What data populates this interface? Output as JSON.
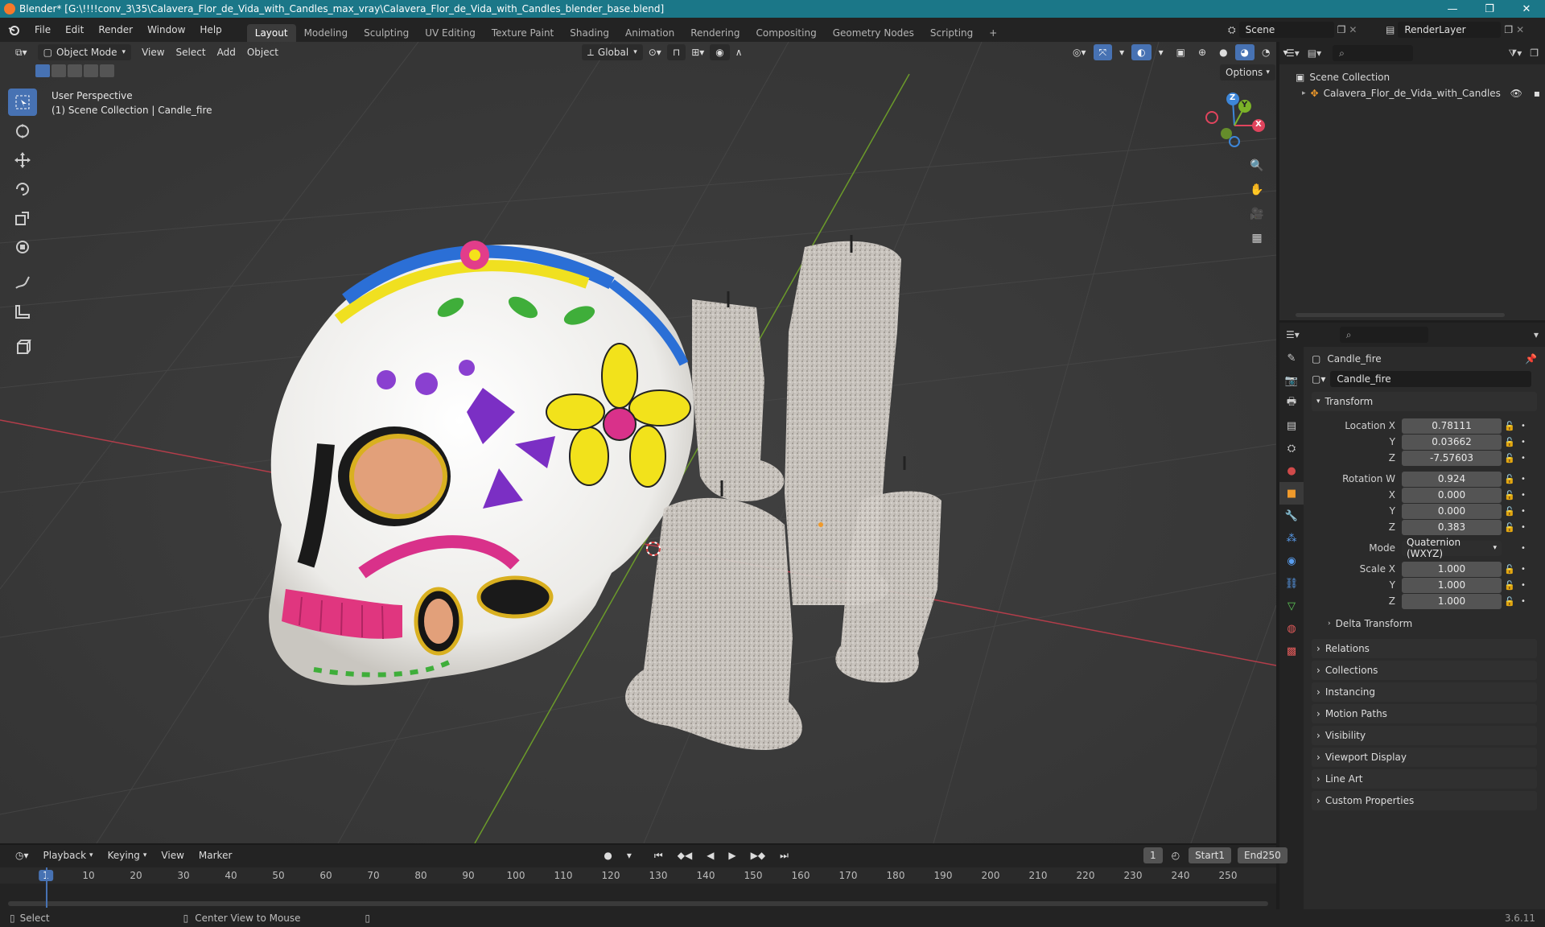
{
  "title_bar": {
    "title": "Blender* [G:\\!!!!conv_3\\35\\Calavera_Flor_de_Vida_with_Candles_max_vray\\Calavera_Flor_de_Vida_with_Candles_blender_base.blend]",
    "minimize": "—",
    "maximize": "❐",
    "close": "✕"
  },
  "menu": [
    "File",
    "Edit",
    "Render",
    "Window",
    "Help"
  ],
  "workspaces": [
    "Layout",
    "Modeling",
    "Sculpting",
    "UV Editing",
    "Texture Paint",
    "Shading",
    "Animation",
    "Rendering",
    "Compositing",
    "Geometry Nodes",
    "Scripting"
  ],
  "workspace_add": "+",
  "scene": {
    "name": "Scene",
    "view_layer": "RenderLayer"
  },
  "viewport": {
    "mode": "Object Mode",
    "menus": [
      "View",
      "Select",
      "Add",
      "Object"
    ],
    "orientation": "Global",
    "options_label": "Options",
    "info_line1": "User Perspective",
    "info_line2": "(1) Scene Collection | Candle_fire"
  },
  "gizmo": {
    "x": "X",
    "y": "Y",
    "z": "Z"
  },
  "colors": {
    "accent": "#4772b3",
    "titlebar": "#1b7788",
    "axis_x": "#e0445d",
    "axis_y": "#7bb228",
    "axis_z": "#3d86d8",
    "origin": "#f09a2b"
  },
  "outliner": {
    "root": "Scene Collection",
    "items": [
      {
        "name": "Calavera_Flor_de_Vida_with_Candles"
      }
    ]
  },
  "properties": {
    "object_name": "Candle_fire",
    "data_name": "Candle_fire",
    "transform_label": "Transform",
    "location_label": "Location X",
    "location": {
      "x": "0.78111",
      "y": "0.03662",
      "z": "-7.57603"
    },
    "rotation_label": "Rotation W",
    "rotation": {
      "w": "0.924",
      "x": "0.000",
      "y": "0.000",
      "z": "0.383"
    },
    "mode_label": "Mode",
    "mode_value": "Quaternion (WXYZ)",
    "scale_label": "Scale X",
    "scale": {
      "x": "1.000",
      "y": "1.000",
      "z": "1.000"
    },
    "axis_y": "Y",
    "axis_x": "X",
    "axis_z": "Z",
    "delta_transform": "Delta Transform",
    "panels": [
      "Relations",
      "Collections",
      "Instancing",
      "Motion Paths",
      "Visibility",
      "Viewport Display",
      "Line Art",
      "Custom Properties"
    ]
  },
  "timeline": {
    "menus": [
      "Playback",
      "Keying",
      "View",
      "Marker"
    ],
    "current_frame": "1",
    "start_label": "Start",
    "start": "1",
    "end_label": "End",
    "end": "250",
    "ruler": [
      "1",
      "10",
      "20",
      "30",
      "40",
      "50",
      "60",
      "70",
      "80",
      "90",
      "100",
      "110",
      "120",
      "130",
      "140",
      "150",
      "160",
      "170",
      "180",
      "190",
      "200",
      "210",
      "220",
      "230",
      "240",
      "250"
    ]
  },
  "status": {
    "select": "Select",
    "center_view": "Center View to Mouse",
    "version": "3.6.11"
  }
}
